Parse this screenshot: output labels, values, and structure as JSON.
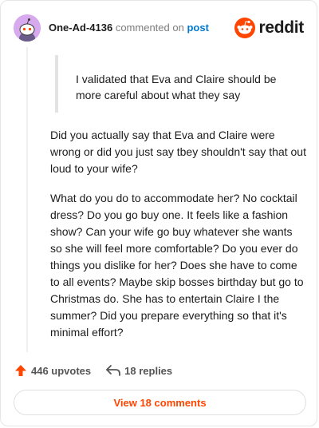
{
  "header": {
    "username": "One-Ad-4136",
    "commented_on": "commented on",
    "post_link": "post",
    "brand": "reddit"
  },
  "quote": {
    "text": "I validated that Eva and Claire should be more careful about what they say"
  },
  "comment": {
    "paragraphs": [
      "Did you actually say that Eva and Claire were wrong or did you just say tbey shouldn't say that out loud to your wife?",
      "What do you do to accommodate her? No cocktail dress? Do you go buy one. It feels like a fashion show? Can your wife go buy whatever she wants so she will feel more comfortable? Do you ever do things you dislike for her? Does she have to come to all events? Maybe skip bosses birthday but go to Christmas do. She has to entertain Claire I the summer? Did you prepare everything so that it's minimal effort?"
    ]
  },
  "actions": {
    "upvotes": "446 upvotes",
    "replies": "18 replies"
  },
  "footer": {
    "view_comments": "View 18 comments"
  },
  "colors": {
    "accent": "#ff4500",
    "link": "#0079d3",
    "avatar_bg": "#d7a9ee"
  }
}
